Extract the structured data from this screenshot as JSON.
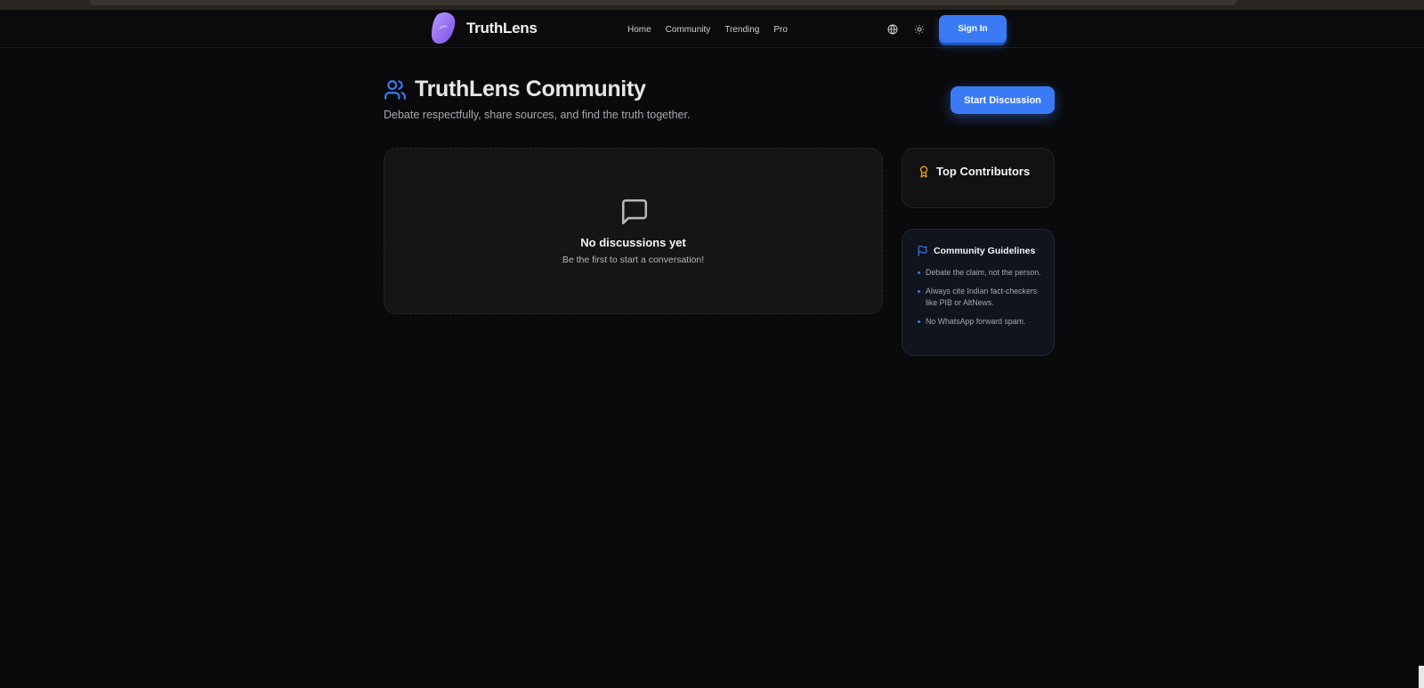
{
  "colors": {
    "accent": "#3a7bf5",
    "brand_logo": "#8b5cf6",
    "award": "#f5a524",
    "background": "#0a0a0c"
  },
  "header": {
    "brand": "TruthLens",
    "nav": [
      "Home",
      "Community",
      "Trending",
      "Pro"
    ],
    "icons": [
      "globe-icon",
      "sun-icon"
    ],
    "signin_label": "Sign In"
  },
  "page": {
    "title": "TruthLens Community",
    "subtitle": "Debate respectfully, share sources, and find the truth together.",
    "start_label": "Start Discussion"
  },
  "empty_state": {
    "icon": "message-square-icon",
    "title": "No discussions yet",
    "subtitle": "Be the first to start a conversation!"
  },
  "sidebar": {
    "contributors": {
      "icon": "award-icon",
      "title": "Top Contributors"
    },
    "guidelines": {
      "icon": "flag-icon",
      "title": "Community Guidelines",
      "items": [
        "Debate the claim, not the person.",
        "Always cite Indian fact-checkers like PIB or AltNews.",
        "No WhatsApp forward spam."
      ]
    }
  }
}
